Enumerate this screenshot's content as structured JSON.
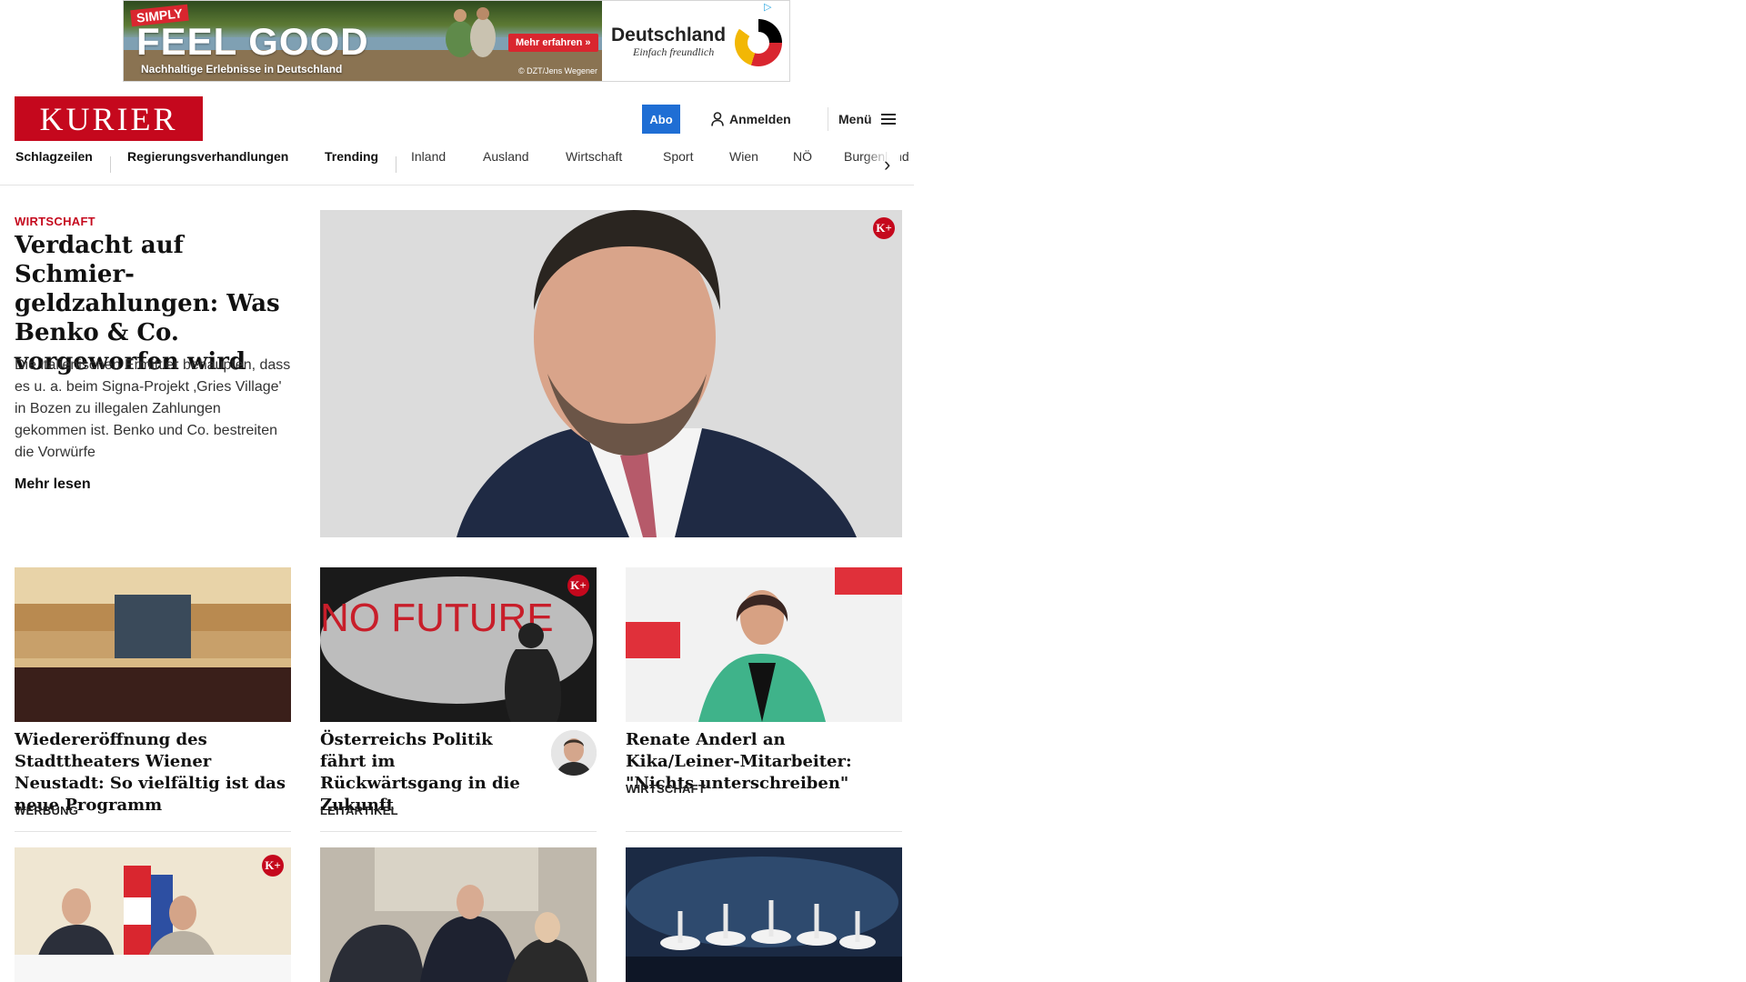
{
  "ad": {
    "badge": "SIMPLY",
    "headline": "FEEL GOOD",
    "subline": "Nachhaltige Erlebnisse in Deutschland",
    "cta": "Mehr erfahren »",
    "credit": "© DZT/Jens Wegener",
    "brand": "Deutschland",
    "tagline": "Einfach freundlich"
  },
  "header": {
    "logo": "KURIER",
    "abo": "Abo",
    "login": "Anmelden",
    "menu": "Menü"
  },
  "nav": {
    "items": [
      "Schlagzeilen",
      "Regierungsverhandlungen",
      "Trending",
      "Inland",
      "Ausland",
      "Wirtschaft",
      "Sport",
      "Wien",
      "NÖ",
      "Burgenland"
    ]
  },
  "lead": {
    "category": "WIRTSCHAFT",
    "title": "Verdacht auf Schmier­geldzahlungen: Was Benko & Co. vorgeworfen wird",
    "teaser": "Die italienischen Ermittler behaupten, dass es u. a. beim Signa-Projekt ‚Gries Village' in Bozen zu illegalen Zahlungen gekommen ist. Benko und Co. bestreiten die Vorwürfe",
    "more": "Mehr lesen",
    "premium_badge": "K+"
  },
  "cards": [
    {
      "title": "Wiedereröffnung des Stadttheaters Wiener Neustadt: So vielfältig ist das neue Programm",
      "category": "WERBUNG"
    },
    {
      "title": "Österreichs Politik fährt im Rückwärtsgang in die Zukunft",
      "category": "LEITARTIKEL",
      "premium_badge": "K+",
      "graffiti": "NO FUTURE"
    },
    {
      "title": "Renate Anderl an Kika/Leiner-Mit­arbeiter: \"Nichts unterschreiben\"",
      "category": "WIRTSCHAFT"
    }
  ],
  "row2": [
    {
      "premium_badge": "K+"
    },
    {},
    {}
  ],
  "colors": {
    "brand_red": "#c5081d",
    "abo_blue": "#1f6ed4"
  }
}
